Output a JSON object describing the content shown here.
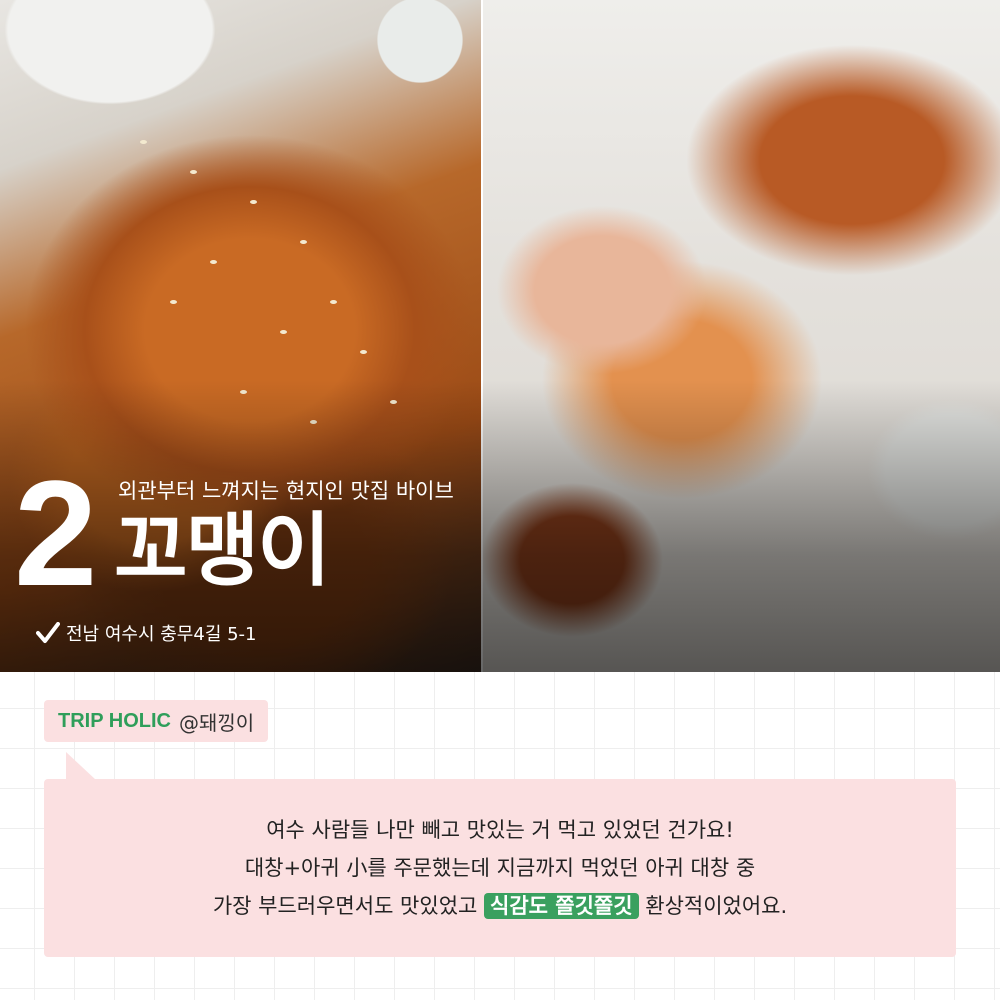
{
  "overlay": {
    "number": "2",
    "tagline": "외관부터 느껴지는 현지인 맛집 바이브",
    "place_name": "꼬맹이",
    "address": "전남 여수시 충무4길 5-1"
  },
  "tag": {
    "brand": "TRIP HOLIC",
    "user": "@돼낑이"
  },
  "review": {
    "line1": "여수 사람들 나만 빼고 맛있는 거 먹고 있었던 건가요!",
    "line2": "대창+아귀 小를 주문했는데 지금까지 먹었던 아귀 대창 중",
    "line3_before": "가장 부드러우면서도 맛있었고 ",
    "line3_highlight": "식감도 쫄깃쫄깃",
    "line3_after": " 환상적이었어요."
  },
  "colors": {
    "accent_green": "#3aa05f",
    "brand_green": "#2f9e5a",
    "bubble_pink": "#fbe0e1"
  },
  "icons": {
    "address": "check-icon"
  }
}
